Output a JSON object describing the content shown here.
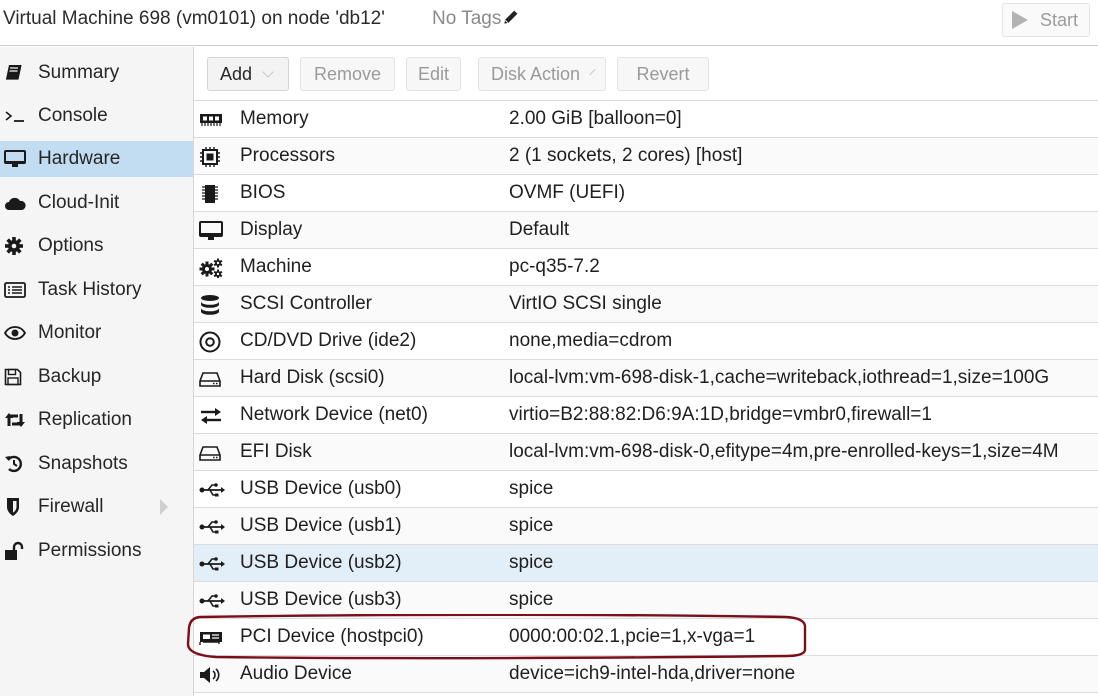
{
  "header": {
    "title": "Virtual Machine 698 (vm0101) on node 'db12'",
    "tags": "No Tags",
    "tags_icon": "pencil-icon",
    "start_label": "Start",
    "start_icon": "play-icon"
  },
  "sidebar": {
    "items": [
      {
        "label": "Summary",
        "icon": "book-icon"
      },
      {
        "label": "Console",
        "icon": "terminal-icon"
      },
      {
        "label": "Hardware",
        "icon": "desktop-icon",
        "active": true
      },
      {
        "label": "Cloud-Init",
        "icon": "cloud-icon"
      },
      {
        "label": "Options",
        "icon": "gear-icon"
      },
      {
        "label": "Task History",
        "icon": "list-icon"
      },
      {
        "label": "Monitor",
        "icon": "eye-icon"
      },
      {
        "label": "Backup",
        "icon": "floppy-icon"
      },
      {
        "label": "Replication",
        "icon": "retweet-icon"
      },
      {
        "label": "Snapshots",
        "icon": "history-icon"
      },
      {
        "label": "Firewall",
        "icon": "shield-icon",
        "expandable": true
      },
      {
        "label": "Permissions",
        "icon": "unlock-icon"
      }
    ]
  },
  "toolbar": {
    "add_label": "Add",
    "remove_label": "Remove",
    "edit_label": "Edit",
    "disk_action_label": "Disk Action",
    "revert_label": "Revert"
  },
  "hardware": {
    "rows": [
      {
        "name": "Memory",
        "value": "2.00 GiB [balloon=0]",
        "icon": "memory-icon"
      },
      {
        "name": "Processors",
        "value": "2 (1 sockets, 2 cores) [host]",
        "icon": "cpu-icon"
      },
      {
        "name": "BIOS",
        "value": "OVMF (UEFI)",
        "icon": "microchip-icon"
      },
      {
        "name": "Display",
        "value": "Default",
        "icon": "monitor-icon"
      },
      {
        "name": "Machine",
        "value": "pc-q35-7.2",
        "icon": "cogs-icon"
      },
      {
        "name": "SCSI Controller",
        "value": "VirtIO SCSI single",
        "icon": "database-icon"
      },
      {
        "name": "CD/DVD Drive (ide2)",
        "value": "none,media=cdrom",
        "icon": "cdrom-icon"
      },
      {
        "name": "Hard Disk (scsi0)",
        "value": "local-lvm:vm-698-disk-1,cache=writeback,iothread=1,size=100G",
        "icon": "hdd-icon"
      },
      {
        "name": "Network Device (net0)",
        "value": "virtio=B2:88:82:D6:9A:1D,bridge=vmbr0,firewall=1",
        "icon": "exchange-icon"
      },
      {
        "name": "EFI Disk",
        "value": "local-lvm:vm-698-disk-0,efitype=4m,pre-enrolled-keys=1,size=4M",
        "icon": "hdd-icon"
      },
      {
        "name": "USB Device (usb0)",
        "value": "spice",
        "icon": "usb-icon"
      },
      {
        "name": "USB Device (usb1)",
        "value": "spice",
        "icon": "usb-icon"
      },
      {
        "name": "USB Device (usb2)",
        "value": "spice",
        "icon": "usb-icon",
        "hover": true
      },
      {
        "name": "USB Device (usb3)",
        "value": "spice",
        "icon": "usb-icon"
      },
      {
        "name": "PCI Device (hostpci0)",
        "value": "0000:00:02.1,pcie=1,x-vga=1",
        "icon": "pci-card-icon",
        "annotated": true
      },
      {
        "name": "Audio Device",
        "value": "device=ich9-intel-hda,driver=none",
        "icon": "volume-icon"
      }
    ]
  },
  "annotation": {
    "color": "#7a0f1a",
    "target": "PCI Device (hostpci0)"
  }
}
